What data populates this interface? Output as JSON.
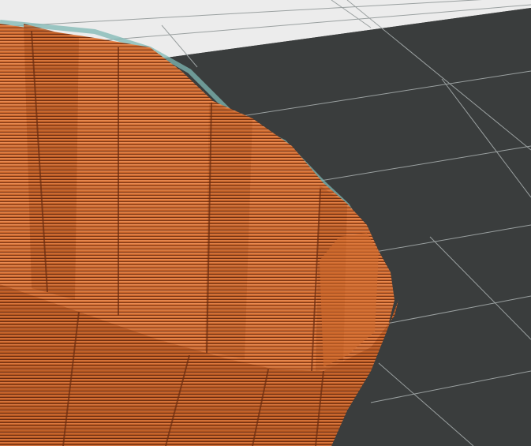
{
  "viewport": {
    "kind": "3d-slicer-layer-preview",
    "colors": {
      "bed_light": "#ececec",
      "bed_dark": "#3a3d3d",
      "grid_line": "#9aa0a0",
      "toolpath_base": "#c8642a",
      "toolpath_dark": "#7a3514",
      "toolpath_light": "#e88a52",
      "travel_cyan": "#7fb8b4"
    }
  }
}
